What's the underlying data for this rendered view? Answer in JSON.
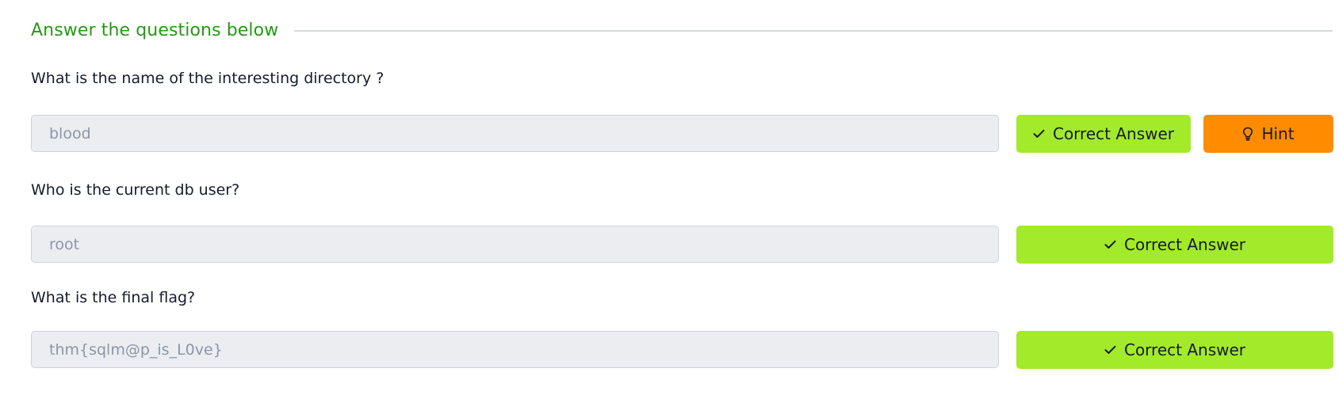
{
  "section": {
    "title": "Answer the questions below"
  },
  "questions": [
    {
      "text": "What is the name of the interesting directory ?",
      "answer": "blood",
      "submit_label": "Correct Answer",
      "hint_label": "Hint"
    },
    {
      "text": "Who is the current db user?",
      "answer": "root",
      "submit_label": "Correct Answer"
    },
    {
      "text": "What is the final flag?",
      "answer": "thm{sqlm@p_is_L0ve}",
      "submit_label": "Correct Answer"
    }
  ],
  "icons": {
    "submit": "check-icon",
    "hint": "lightbulb-icon"
  },
  "colors": {
    "section_title": "#249a13",
    "correct_button": "#a3ea2a",
    "hint_button": "#ff8b00",
    "field_background": "#ebedf1",
    "field_text": "#8d96a5"
  }
}
